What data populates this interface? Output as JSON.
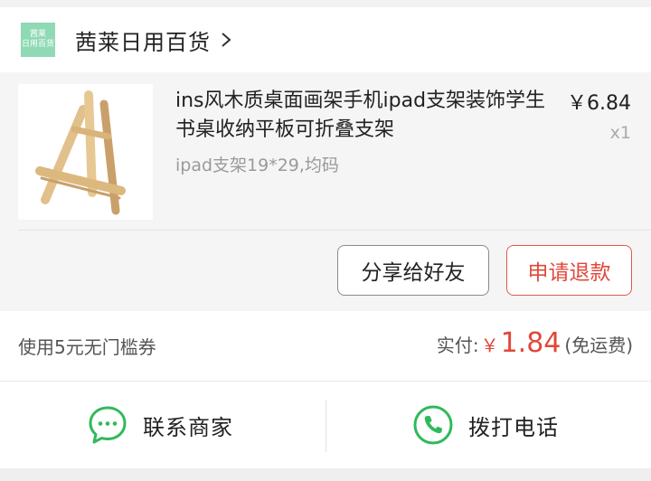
{
  "shop": {
    "logo_line1": "茜莱",
    "logo_line2": "日用百货",
    "name": "茜莱日用百货",
    "chevron_icon": "chevron-right-icon"
  },
  "product": {
    "title": "ins风木质桌面画架手机ipad支架装饰学生书桌收纳平板可折叠支架",
    "spec": "ipad支架19*29,均码",
    "price": "￥6.84",
    "quantity": "x1",
    "image_icon": "wooden-easel-image"
  },
  "actions": {
    "share_label": "分享给好友",
    "refund_label": "申请退款"
  },
  "payment": {
    "coupon": "使用5元无门槛券",
    "paid_label": "实付:",
    "currency": "￥",
    "amount": "1.84",
    "note": "(免运费)"
  },
  "contact": {
    "contact_label": "联系商家",
    "call_label": "拨打电话",
    "contact_icon": "chat-bubble-icon",
    "call_icon": "phone-icon"
  },
  "colors": {
    "accent_green": "#2fba5a",
    "accent_red": "#e0483a",
    "logo_green": "#8fd9b5"
  }
}
